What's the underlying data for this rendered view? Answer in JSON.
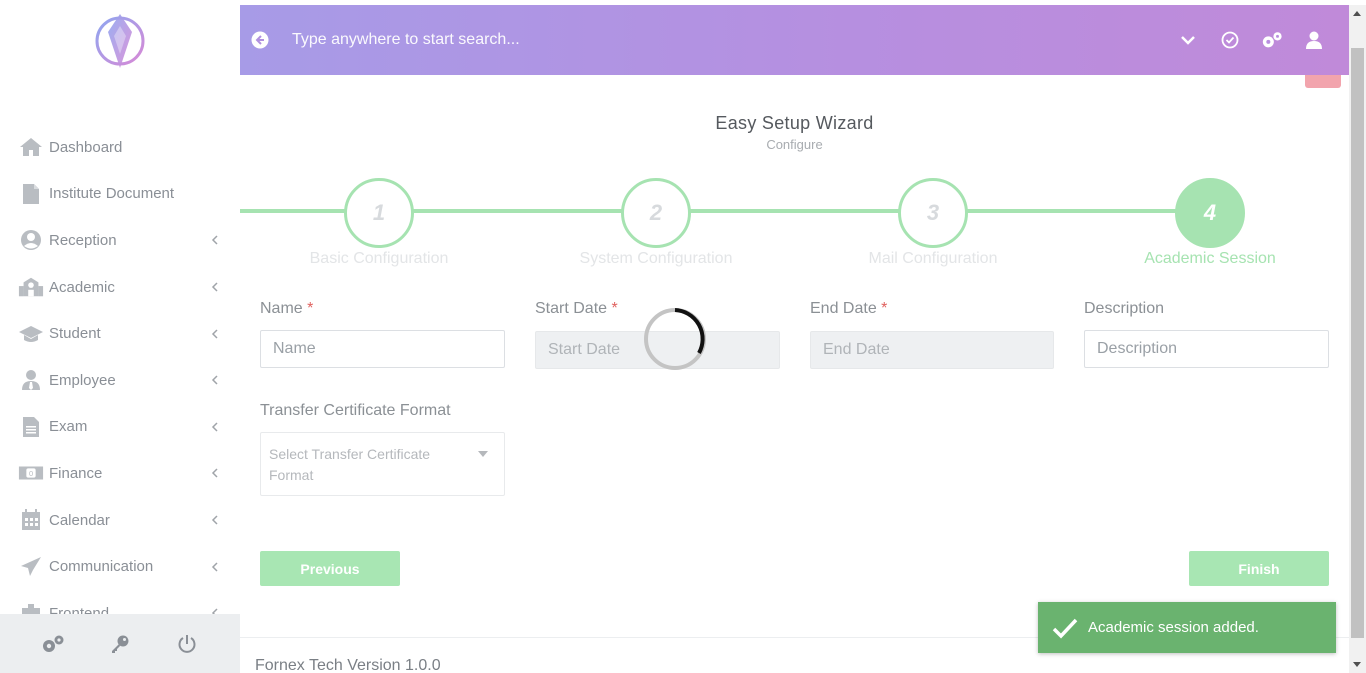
{
  "sidebar": {
    "items": [
      {
        "label": "Dashboard",
        "icon": "home-icon",
        "has_submenu": false
      },
      {
        "label": "Institute Document",
        "icon": "document-icon",
        "has_submenu": false
      },
      {
        "label": "Reception",
        "icon": "user-circle-icon",
        "has_submenu": true
      },
      {
        "label": "Academic",
        "icon": "school-icon",
        "has_submenu": true
      },
      {
        "label": "Student",
        "icon": "graduation-cap-icon",
        "has_submenu": true
      },
      {
        "label": "Employee",
        "icon": "user-tie-icon",
        "has_submenu": true
      },
      {
        "label": "Exam",
        "icon": "file-text-icon",
        "has_submenu": true
      },
      {
        "label": "Finance",
        "icon": "money-icon",
        "has_submenu": true
      },
      {
        "label": "Calendar",
        "icon": "calendar-icon",
        "has_submenu": true
      },
      {
        "label": "Communication",
        "icon": "paper-plane-icon",
        "has_submenu": true
      },
      {
        "label": "Frontend",
        "icon": "building-icon",
        "has_submenu": true
      }
    ],
    "footer_icons": [
      "settings-icon",
      "key-icon",
      "power-icon"
    ]
  },
  "topbar": {
    "search_placeholder": "Type anywhere to start search...",
    "icons": [
      "chevron-down-icon",
      "check-circle-icon",
      "cogs-icon",
      "user-icon"
    ]
  },
  "wizard": {
    "title": "Easy Setup Wizard",
    "subtitle": "Configure",
    "steps": [
      {
        "number": "1",
        "label": "Basic Configuration",
        "active": false
      },
      {
        "number": "2",
        "label": "System Configuration",
        "active": false
      },
      {
        "number": "3",
        "label": "Mail Configuration",
        "active": false
      },
      {
        "number": "4",
        "label": "Academic Session",
        "active": true
      }
    ]
  },
  "form": {
    "name": {
      "label": "Name",
      "required_mark": "*",
      "placeholder": "Name",
      "value": ""
    },
    "start_date": {
      "label": "Start Date",
      "required_mark": "*",
      "placeholder": "Start Date",
      "value": ""
    },
    "end_date": {
      "label": "End Date",
      "required_mark": "*",
      "placeholder": "End Date",
      "value": ""
    },
    "description": {
      "label": "Description",
      "placeholder": "Description",
      "value": ""
    },
    "tc_format": {
      "label": "Transfer Certificate Format",
      "placeholder": "Select Transfer Certificate Format"
    }
  },
  "buttons": {
    "previous": "Previous",
    "finish": "Finish"
  },
  "footer": {
    "version_text": "Fornex Tech Version 1.0.0"
  },
  "toast": {
    "message": "Academic session added."
  },
  "colors": {
    "accent_green": "#a6e3b1",
    "toast_green": "#6ab36f",
    "header_gradient_start": "#a79be7",
    "header_gradient_end": "#c08ad9",
    "required_red": "#e0615e"
  }
}
